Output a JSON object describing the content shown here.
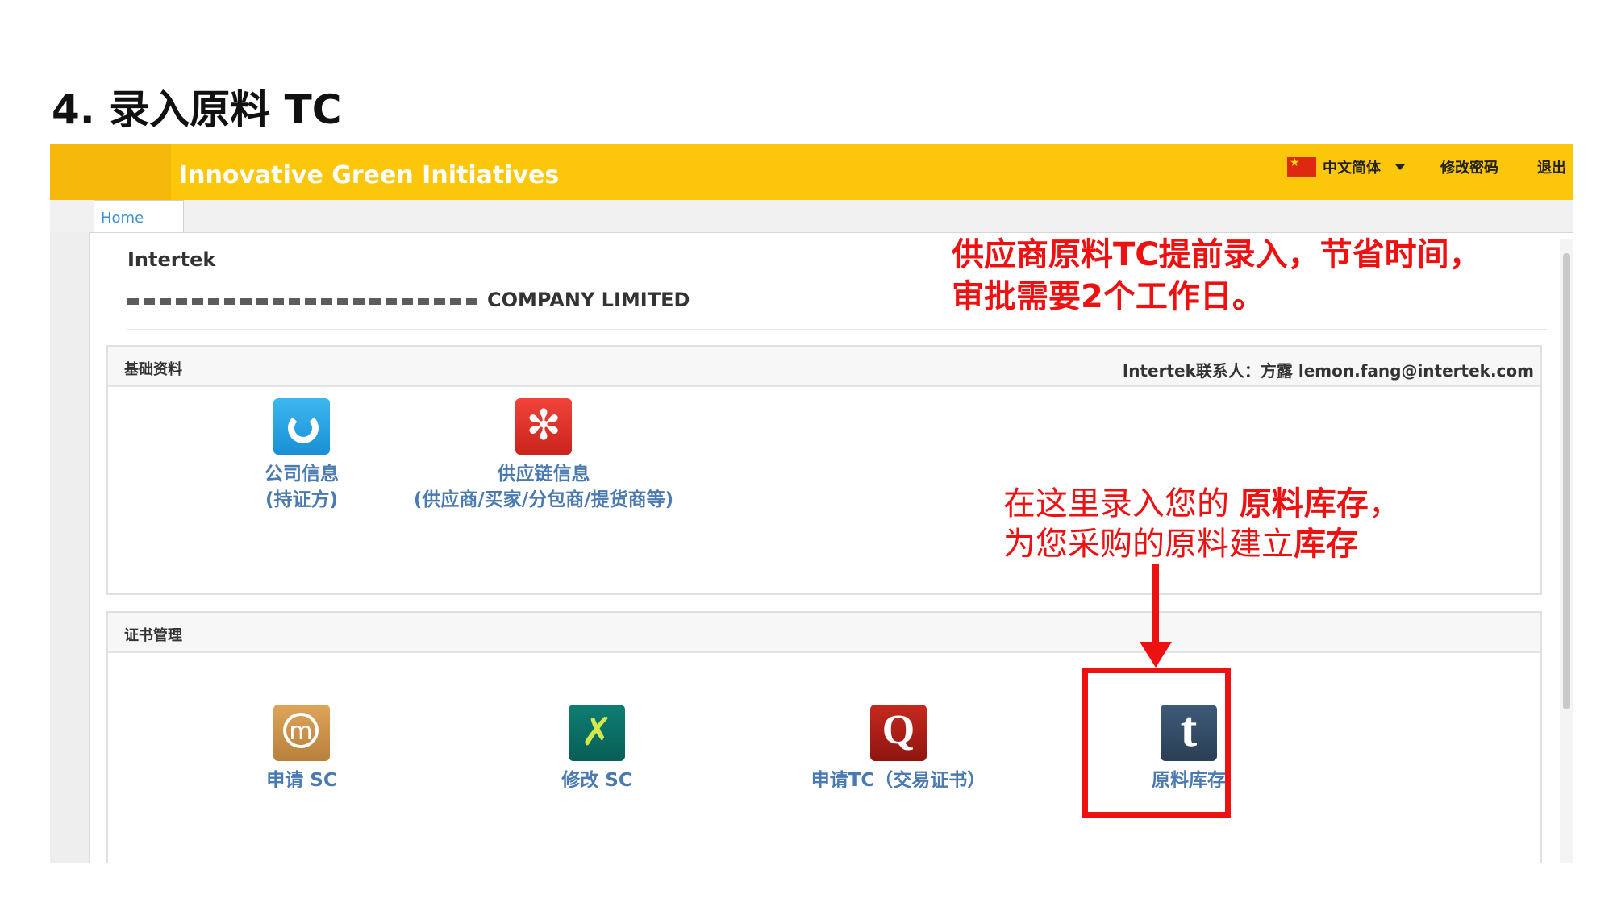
{
  "slide": {
    "title": "4. 录入原料 TC"
  },
  "header": {
    "app_title": "Innovative Green Initiatives",
    "language": "中文简体",
    "flag_icon": "china-flag-icon",
    "change_password": "修改密码",
    "logout": "退出",
    "bar_color": "#fcc60a"
  },
  "tabs": {
    "home": "Home"
  },
  "company": {
    "org": "Intertek",
    "name": "COMPANY LIMITED"
  },
  "basic_panel": {
    "title": "基础资料",
    "contact": "Intertek联系人：方露 lemon.fang@intertek.com",
    "tiles": [
      {
        "line1": "公司信息",
        "line2": "(持证方)",
        "icon": "refresh-icon"
      },
      {
        "line1": "供应链信息",
        "line2": "(供应商/买家/分包商/提货商等)",
        "icon": "yelp-icon"
      }
    ]
  },
  "cert_panel": {
    "title": "证书管理",
    "tiles": [
      {
        "label": "申请 SC",
        "icon": "chat-m-icon"
      },
      {
        "label": "修改 SC",
        "icon": "xing-icon"
      },
      {
        "label": "申请TC（交易证书）",
        "icon": "quora-q-icon"
      },
      {
        "label": "原料库存",
        "icon": "tumblr-t-icon"
      }
    ]
  },
  "annotations": {
    "top_line1": "供应商原料TC提前录入，节省时间，",
    "top_line2": "审批需要2个工作日。",
    "mid_line1_a": "在这里录入您的 ",
    "mid_line1_b": "原料库存",
    "mid_line1_c": "，",
    "mid_line2_a": "为您采购的原料建立",
    "mid_line2_b": "库存",
    "accent_color": "#ee1111"
  }
}
